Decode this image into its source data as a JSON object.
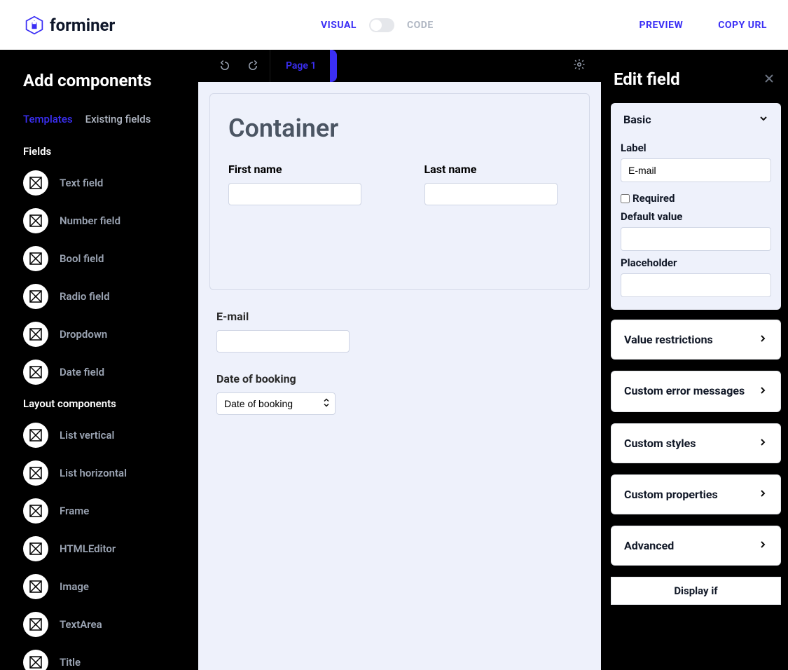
{
  "header": {
    "brand": "forminer",
    "tab_visual": "VISUAL",
    "tab_code": "CODE",
    "link_preview": "PREVIEW",
    "link_copy_url": "COPY URL"
  },
  "left": {
    "title": "Add components",
    "subtabs": {
      "templates": "Templates",
      "existing": "Existing fields"
    },
    "section_fields": "Fields",
    "fields": [
      {
        "label": "Text field"
      },
      {
        "label": "Number field"
      },
      {
        "label": "Bool field"
      },
      {
        "label": "Radio field"
      },
      {
        "label": "Dropdown"
      },
      {
        "label": "Date field"
      }
    ],
    "section_layout": "Layout components",
    "layout": [
      {
        "label": "List vertical"
      },
      {
        "label": "List horizontal"
      },
      {
        "label": "Frame"
      },
      {
        "label": "HTMLEditor"
      },
      {
        "label": "Image"
      },
      {
        "label": "TextArea"
      },
      {
        "label": "Title"
      }
    ]
  },
  "center": {
    "page_tab": "Page 1",
    "container_title": "Container",
    "first_name_label": "First name",
    "last_name_label": "Last name",
    "email_label": "E-mail",
    "date_label": "Date of booking",
    "date_selected": "Date of booking"
  },
  "right": {
    "title": "Edit field",
    "basic": {
      "header": "Basic",
      "label_label": "Label",
      "label_value": "E-mail",
      "required_label": "Required",
      "default_label": "Default value",
      "default_value": "",
      "placeholder_label": "Placeholder",
      "placeholder_value": ""
    },
    "sections": {
      "value_restrictions": "Value restrictions",
      "custom_error": "Custom error messages",
      "custom_styles": "Custom styles",
      "custom_properties": "Custom properties",
      "advanced": "Advanced"
    },
    "display_if": "Display if"
  }
}
